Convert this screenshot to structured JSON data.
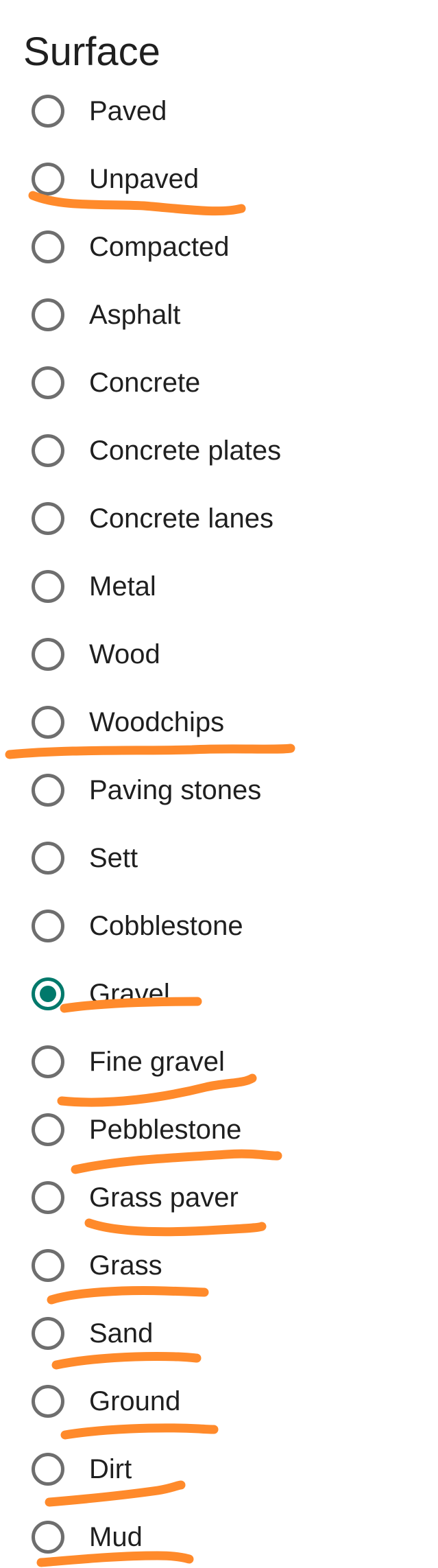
{
  "section": {
    "title": "Surface"
  },
  "options": [
    {
      "label": "Paved",
      "checked": false
    },
    {
      "label": "Unpaved",
      "checked": false
    },
    {
      "label": "Compacted",
      "checked": false
    },
    {
      "label": "Asphalt",
      "checked": false
    },
    {
      "label": "Concrete",
      "checked": false
    },
    {
      "label": "Concrete plates",
      "checked": false
    },
    {
      "label": "Concrete lanes",
      "checked": false
    },
    {
      "label": "Metal",
      "checked": false
    },
    {
      "label": "Wood",
      "checked": false
    },
    {
      "label": "Woodchips",
      "checked": false
    },
    {
      "label": "Paving stones",
      "checked": false
    },
    {
      "label": "Sett",
      "checked": false
    },
    {
      "label": "Cobblestone",
      "checked": false
    },
    {
      "label": "Gravel",
      "checked": true
    },
    {
      "label": "Fine gravel",
      "checked": false
    },
    {
      "label": "Pebblestone",
      "checked": false
    },
    {
      "label": "Grass paver",
      "checked": false
    },
    {
      "label": "Grass",
      "checked": false
    },
    {
      "label": "Sand",
      "checked": false
    },
    {
      "label": "Ground",
      "checked": false
    },
    {
      "label": "Dirt",
      "checked": false
    },
    {
      "label": "Mud",
      "checked": false
    }
  ],
  "colors": {
    "radio_unchecked": "#6e6e6e",
    "radio_checked": "#00796b",
    "annotation_stroke": "#ff8a2b"
  }
}
